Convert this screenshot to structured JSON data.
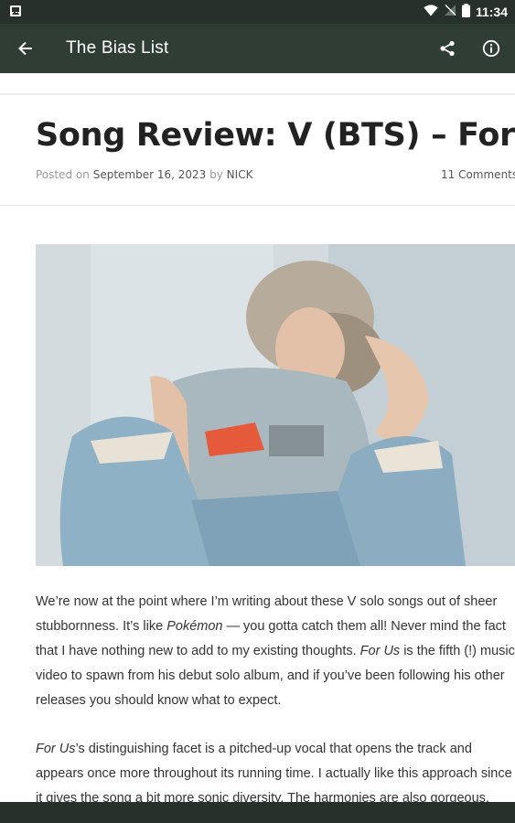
{
  "status_bar": {
    "time": "11:34"
  },
  "app_bar": {
    "title": "The Bias List"
  },
  "post": {
    "title": "Song Review: V (BTS) – For Us",
    "meta": {
      "posted_on_label": "Posted on",
      "date": "September 16, 2023",
      "by_label": "by",
      "author": "NICK",
      "comments": "11 Comments"
    },
    "paragraphs": [
      {
        "lines": [
          [
            {
              "t": "We’re now at the point where I’m writing about these V solo songs out of sheer"
            }
          ],
          [
            {
              "t": "stubbornness. It’s like "
            },
            {
              "t": "Pokémon",
              "i": true
            },
            {
              "t": " — you gotta catch them all! Never mind the fact"
            }
          ],
          [
            {
              "t": "that I have nothing new to add to my existing thoughts. "
            },
            {
              "t": "For Us",
              "i": true
            },
            {
              "t": " is the fifth (!) music"
            }
          ],
          [
            {
              "t": "video to spawn from his debut solo album, and if you’ve been following his other"
            }
          ],
          [
            {
              "t": "releases you should know what to expect."
            }
          ]
        ]
      },
      {
        "lines": [
          [
            {
              "t": "For Us",
              "i": true
            },
            {
              "t": "’s distinguishing facet is a pitched-up vocal that opens the track and"
            }
          ],
          [
            {
              "t": "appears once more throughout its running time. I actually like this approach since"
            }
          ],
          [
            {
              "t": "it gives the song a bit more sonic diversity. The harmonies are also gorgeous,"
            }
          ]
        ]
      }
    ]
  }
}
